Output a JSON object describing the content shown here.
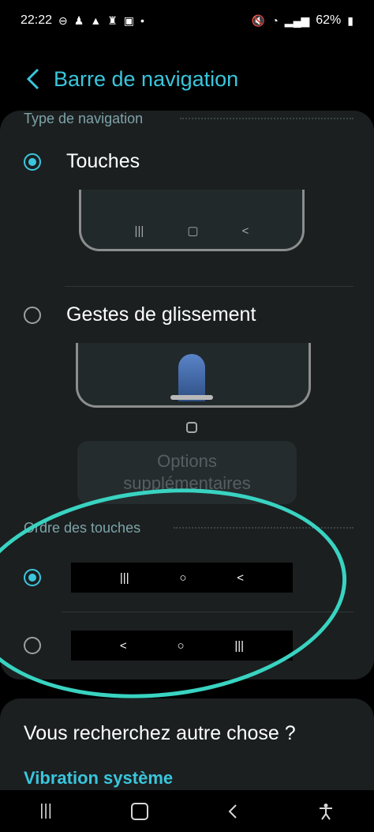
{
  "status_bar": {
    "time": "22:22",
    "battery": "62%",
    "left_icons": [
      "do-not-disturb-icon",
      "settings-icon",
      "warning-icon",
      "lock-icon",
      "image-icon",
      "dot-icon"
    ],
    "right_icons": [
      "mute-icon",
      "wifi-icon",
      "signal-icon",
      "battery-icon"
    ]
  },
  "header": {
    "title": "Barre de navigation"
  },
  "navigation_type": {
    "section_title": "Type de navigation",
    "options": [
      {
        "label": "Touches",
        "selected": true
      },
      {
        "label": "Gestes de glissement",
        "selected": false
      }
    ],
    "more_options_label": "Options supplémentaires",
    "gesture_indicator_icon": "circle-icon"
  },
  "button_order": {
    "section_title": "Ordre des touches",
    "options": [
      {
        "selected": true,
        "buttons": [
          "|||",
          "○",
          "<"
        ]
      },
      {
        "selected": false,
        "buttons": [
          "<",
          "○",
          "|||"
        ]
      }
    ]
  },
  "search_more": {
    "title": "Vous recherchez autre chose ?",
    "link": "Vibration système"
  },
  "nav_bar": {
    "icons": [
      "recents-icon",
      "home-icon",
      "back-icon",
      "accessibility-icon"
    ]
  }
}
